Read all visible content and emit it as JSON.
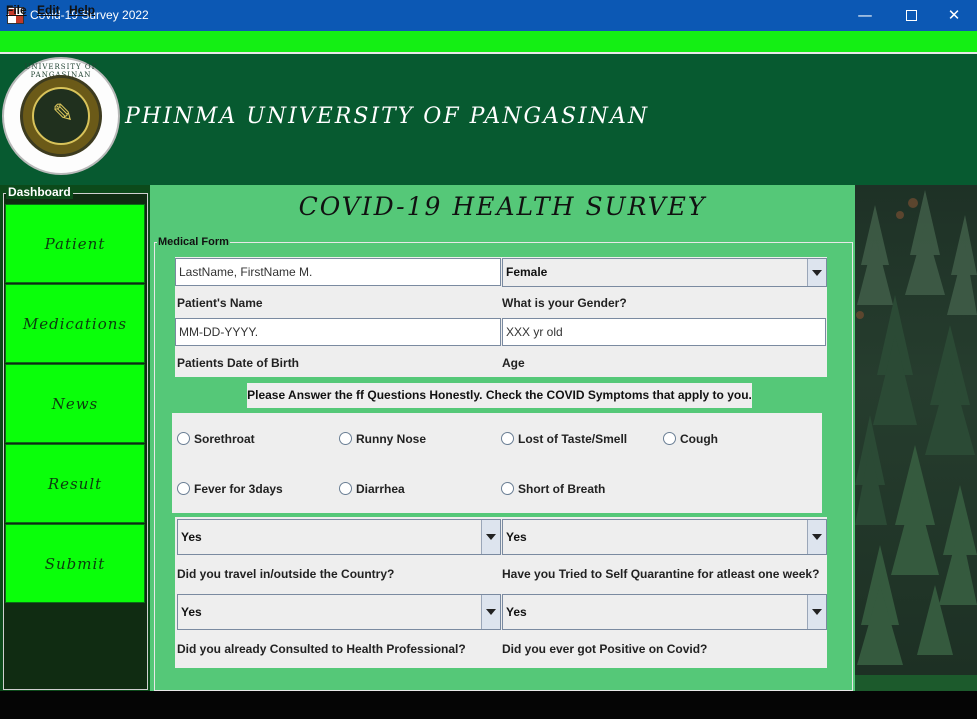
{
  "window": {
    "title": "Covid-19 Survey 2022",
    "minimize": "—",
    "maximize": "",
    "close": "✕"
  },
  "menu": [
    "File",
    "Edit",
    "Help"
  ],
  "header": {
    "university": "PHINMA UNIVERSITY OF PANGASINAN",
    "logo_text": "UNIVERSITY OF PANGASINAN"
  },
  "sidebar": {
    "title": "Dashboard",
    "items": [
      "Patient",
      "Medications",
      "News",
      "Result",
      "Submit"
    ]
  },
  "survey": {
    "title": "COVID-19 HEALTH SURVEY",
    "form_title": "Medical Form"
  },
  "fields": {
    "name_value": "LastName, FirstName M.",
    "name_label": "Patient's Name",
    "gender_value": "Female",
    "gender_label": "What is your Gender?",
    "dob_value": "MM-DD-YYYY.",
    "dob_label": "Patients Date of Birth",
    "age_value": "XXX yr old",
    "age_label": "Age"
  },
  "instruction": "Please Answer the ff Questions Honestly. Check the COVID Symptoms that apply to you.",
  "symptoms": [
    "Sorethroat",
    "Runny Nose",
    "Lost of Taste/Smell",
    "Cough",
    "Fever for 3days",
    "Diarrhea",
    "Short of Breath"
  ],
  "questions": {
    "travel": {
      "value": "Yes",
      "label": "Did you travel in/outside the Country?"
    },
    "quarantine": {
      "value": "Yes",
      "label": "Have you Tried to Self Quarantine for atleast one week?"
    },
    "consulted": {
      "value": "Yes",
      "label": "Did you already Consulted to Health Professional?"
    },
    "positive": {
      "value": "Yes",
      "label": "Did you ever got Positive on Covid?"
    }
  }
}
